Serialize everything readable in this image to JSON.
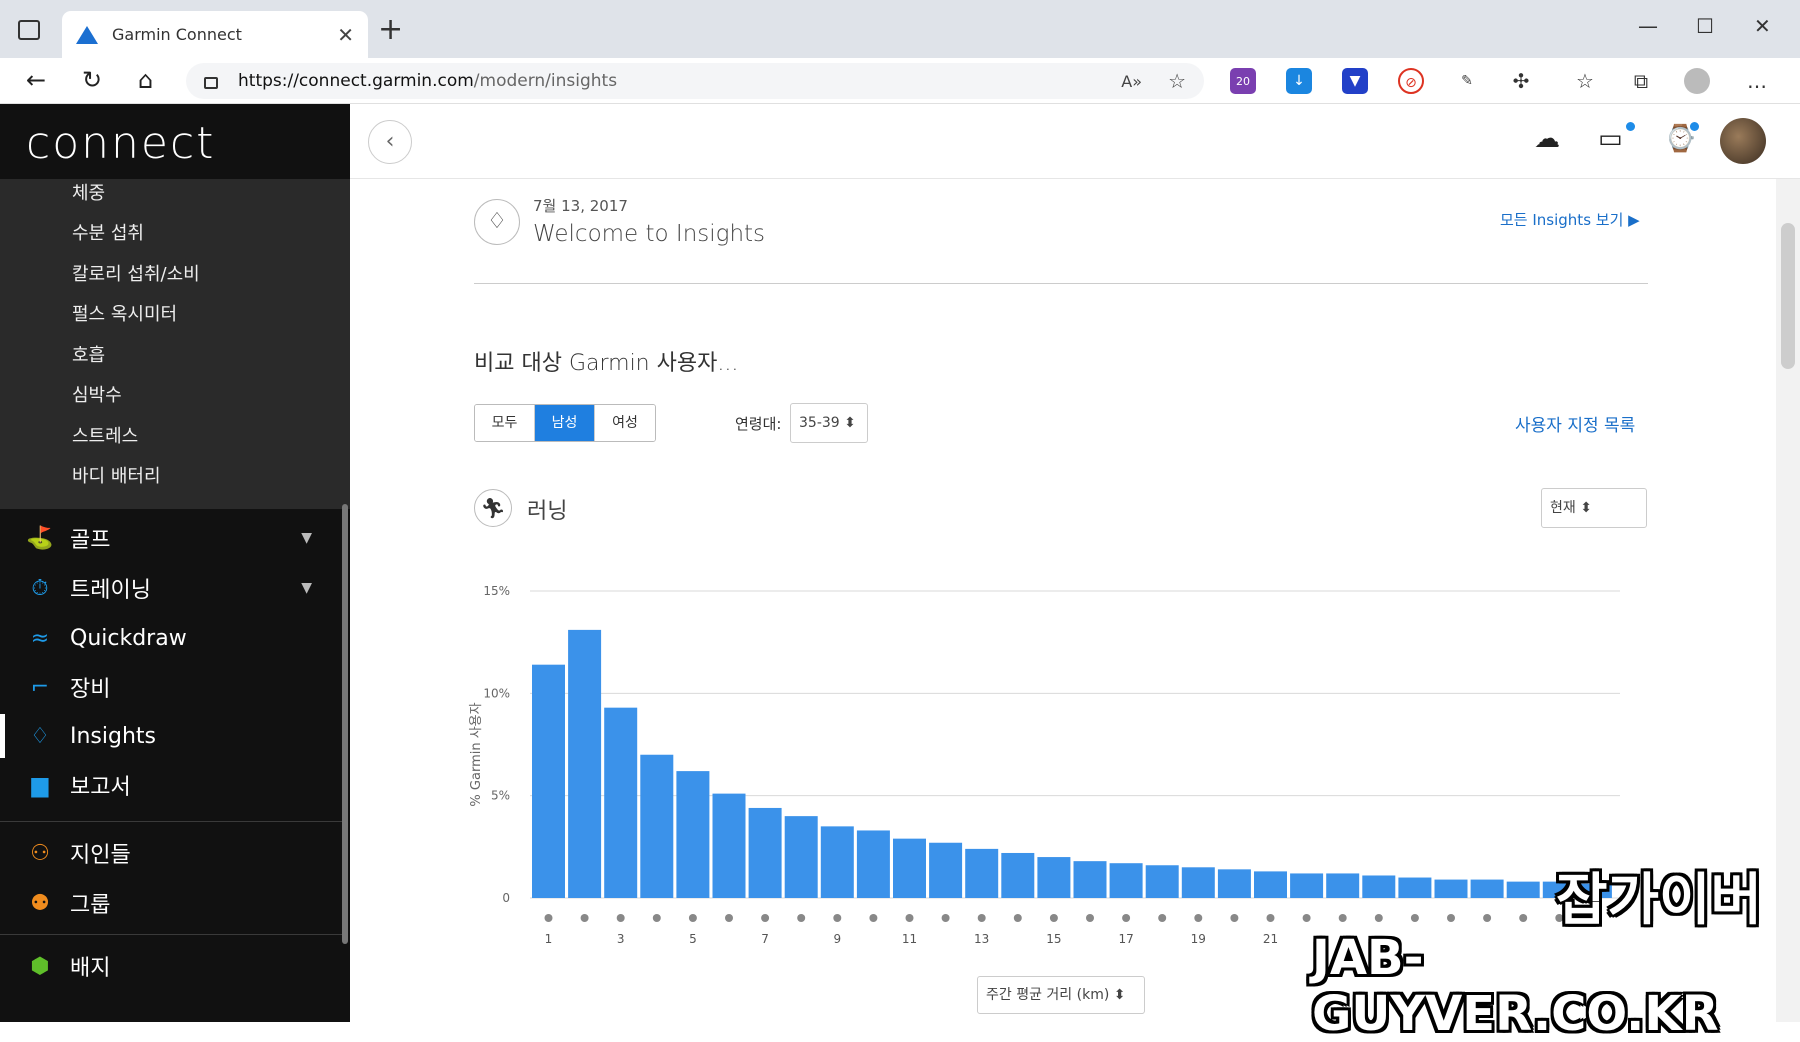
{
  "browser": {
    "tab_title": "Garmin Connect",
    "url_host": "https://connect.garmin.com",
    "url_path": "/modern/insights",
    "ext_badge": "20"
  },
  "app": {
    "logo": "connect",
    "sub_items": [
      "체중",
      "수분 섭취",
      "칼로리 섭취/소비",
      "펄스 옥시미터",
      "호흡",
      "심박수",
      "스트레스",
      "바디 배터리"
    ],
    "nav": [
      {
        "label": "골프",
        "icon": "golf-icon"
      },
      {
        "label": "트레이닝",
        "icon": "stopwatch-icon"
      },
      {
        "label": "Quickdraw",
        "icon": "quickdraw-icon"
      },
      {
        "label": "장비",
        "icon": "shoe-icon"
      },
      {
        "label": "Insights",
        "icon": "lightbulb-icon"
      },
      {
        "label": "보고서",
        "icon": "bar-chart-icon"
      },
      {
        "label": "지인들",
        "icon": "people-icon"
      },
      {
        "label": "그룹",
        "icon": "group-icon"
      },
      {
        "label": "배지",
        "icon": "badge-icon"
      }
    ]
  },
  "insight": {
    "date": "7월 13, 2017",
    "title": "Welcome to Insights",
    "all_link": "모든 Insights 보기 ▶",
    "compare_label": "비교 대상 Garmin 사용자...",
    "segments": [
      "모두",
      "남성",
      "여성"
    ],
    "selected_segment": "남성",
    "age_label": "연령대:",
    "age_value": "35-39",
    "custom_list": "사용자 지정 목록",
    "activity": "러닝",
    "period": "현재",
    "x_select": "주간 평균 거리 (km)"
  },
  "watermark": {
    "line1": "잡가이버",
    "line2": "JAB-GUYVER.CO.KR"
  },
  "chart_data": {
    "type": "bar",
    "ylabel": "% Garmin 사용자",
    "ylim": [
      0,
      15
    ],
    "yticks": [
      "0",
      "5%",
      "10%",
      "15%"
    ],
    "x": [
      1,
      2,
      3,
      4,
      5,
      6,
      7,
      8,
      9,
      10,
      11,
      12,
      13,
      14,
      15,
      16,
      17,
      18,
      19,
      20,
      21,
      22,
      23,
      24,
      25,
      26,
      27,
      28,
      29,
      30
    ],
    "xtick_labels": [
      "1",
      "3",
      "5",
      "7",
      "9",
      "11",
      "13",
      "15",
      "17",
      "19",
      "21"
    ],
    "values": [
      11.4,
      13.1,
      9.3,
      7.0,
      6.2,
      5.1,
      4.4,
      4.0,
      3.5,
      3.3,
      2.9,
      2.7,
      2.4,
      2.2,
      2.0,
      1.8,
      1.7,
      1.6,
      1.5,
      1.4,
      1.3,
      1.2,
      1.2,
      1.1,
      1.0,
      0.9,
      0.9,
      0.8,
      0.8,
      0.7
    ],
    "bar_color": "#3b92ea"
  }
}
